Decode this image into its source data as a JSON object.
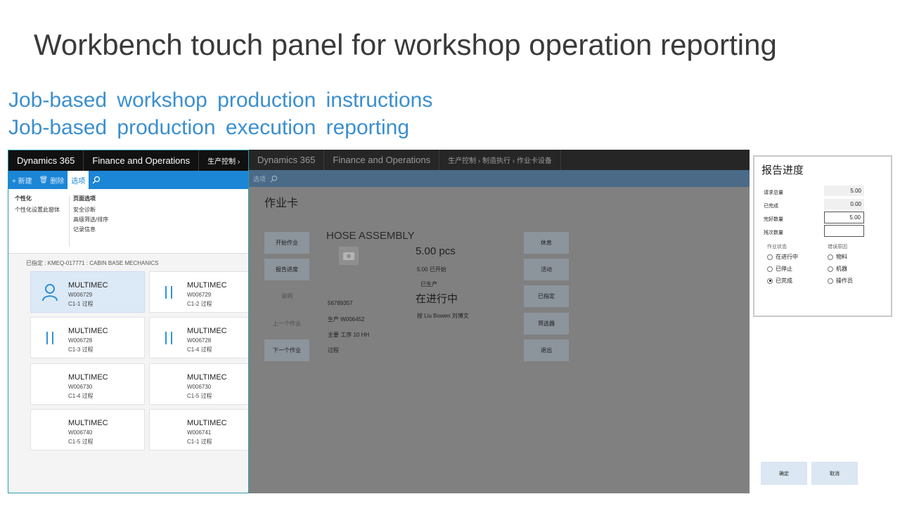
{
  "slide": {
    "title": "Workbench touch panel for workshop operation reporting",
    "subtitle_1": "Job-based workshop production instructions",
    "subtitle_2": "Job-based production execution reporting"
  },
  "left": {
    "topbar": {
      "brand": "Dynamics 365",
      "product": "Finance and Operations",
      "crumb": "生产控制 ›"
    },
    "ribbon": {
      "new": "+ 新建",
      "delete": "删除",
      "options": "选项"
    },
    "menu": {
      "col1_header": "个性化",
      "col1_items": [
        "个性化设置此窗体"
      ],
      "col2_header": "页面选项",
      "col2_items": [
        "安全诊断",
        "高级筛选/排序",
        "记录信息"
      ]
    },
    "assigned": "已指定 : KMEQ-017771 : CABIN BASE MECHANICS",
    "cards": [
      {
        "title": "MULTIMEC",
        "id": "W006729",
        "op": "C1-1 过程",
        "icon": "person-icon"
      },
      {
        "title": "MULTIMEC",
        "id": "W006729",
        "op": "C1-2 过程",
        "icon": "pause-icon"
      },
      {
        "title": "MULTIMEC",
        "id": "W006728",
        "op": "C1-3 过程",
        "icon": "pause-icon"
      },
      {
        "title": "MULTIMEC",
        "id": "W006728",
        "op": "C1-4 过程",
        "icon": "pause-icon"
      },
      {
        "title": "MULTIMEC",
        "id": "W006730",
        "op": "C1-4 过程",
        "icon": ""
      },
      {
        "title": "MULTIMEC",
        "id": "W006730",
        "op": "C1-5 过程",
        "icon": ""
      },
      {
        "title": "MULTIMEC",
        "id": "W006740",
        "op": "C1-5 过程",
        "icon": ""
      },
      {
        "title": "MULTIMEC",
        "id": "W006741",
        "op": "C1-1 过程",
        "icon": ""
      }
    ]
  },
  "middle": {
    "topbar": {
      "brand": "Dynamics 365",
      "product": "Finance and Operations",
      "crumb": "生产控制  ›  制造执行  ›  作业卡设备"
    },
    "ribbon": {
      "options": "选项"
    },
    "page_title": "作业卡",
    "left_buttons": [
      "开始作业",
      "报告进度",
      "说明",
      "上一个作业",
      "下一个作业"
    ],
    "right_buttons": [
      "休息",
      "活动",
      "已指定",
      "筛选器",
      "退出"
    ],
    "item_name": "HOSE ASSEMBLY",
    "quantity": "5.00 pcs",
    "started": "5.00 已开始",
    "produced": "已生产",
    "status": "在进行中",
    "by": "按 Liu Bowen 刘博文",
    "job_number": "56789357",
    "production": "生产 W006452",
    "primary_op": "主要 工序 10 HH",
    "process": "过程"
  },
  "dialog": {
    "title": "报告进度",
    "fields": [
      {
        "label": "请求总量",
        "value": "5.00"
      },
      {
        "label": "已完成",
        "value": "0.00"
      },
      {
        "label": "完好数量",
        "value": "5.00"
      },
      {
        "label": "残次数量",
        "value": ""
      }
    ],
    "status_header": "作业状态",
    "status_options": [
      "在进行中",
      "已停止",
      "已完成"
    ],
    "status_selected": "已完成",
    "reason_header": "错误原因",
    "reason_options": [
      "物料",
      "机器",
      "操作员"
    ],
    "ok": "确定",
    "cancel": "取消"
  }
}
